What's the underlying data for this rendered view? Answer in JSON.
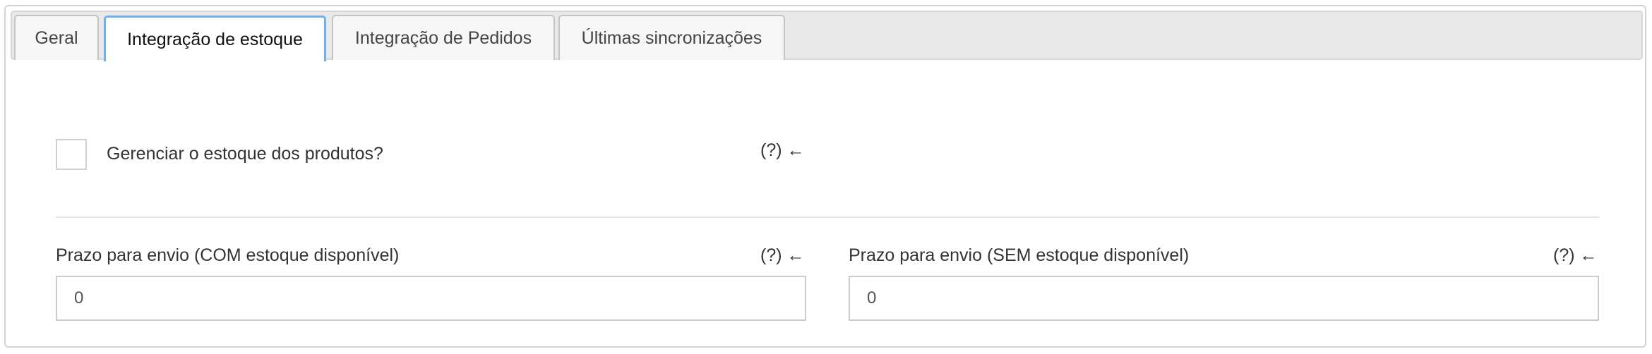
{
  "tabs": [
    {
      "label": "Geral",
      "active": false
    },
    {
      "label": "Integração de estoque",
      "active": true
    },
    {
      "label": "Integração de Pedidos",
      "active": false
    },
    {
      "label": "Últimas sincronizações",
      "active": false
    }
  ],
  "stock": {
    "manage_label": "Gerenciar o estoque dos produtos?",
    "manage_checked": false,
    "manage_help": "(?) ←"
  },
  "shipping": {
    "with_stock": {
      "label": "Prazo para envio (COM estoque disponível)",
      "help": "(?) ←",
      "value": "0"
    },
    "without_stock": {
      "label": "Prazo para envio (SEM estoque disponível)",
      "help": "(?) ←",
      "value": "0"
    }
  },
  "colors": {
    "active_tab_border": "#6fb0ee",
    "tabbar_background": "#e9e9e9"
  }
}
